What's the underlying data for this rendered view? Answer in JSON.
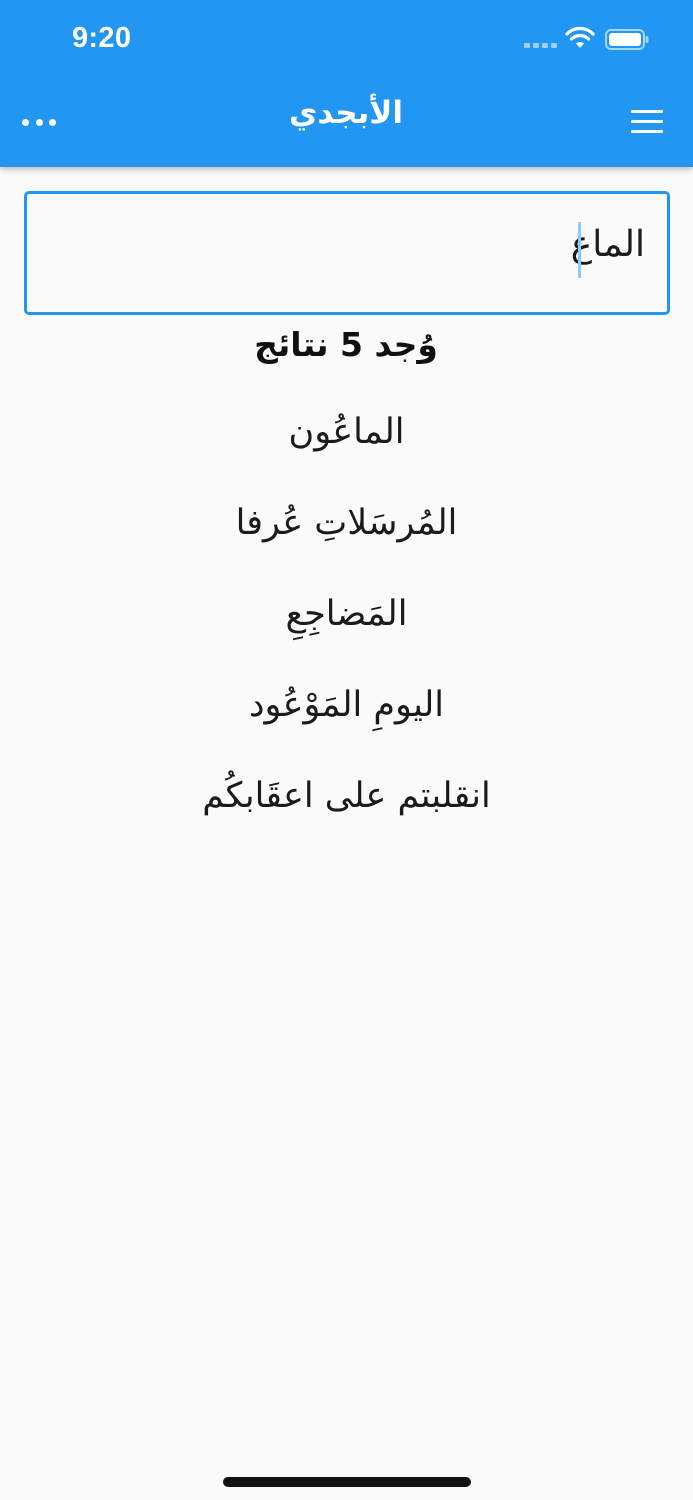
{
  "status_bar": {
    "time": "9:20"
  },
  "app_bar": {
    "title": "الأبجدي",
    "more_icon": "more-horizontal-icon",
    "menu_icon": "hamburger-menu-icon"
  },
  "search": {
    "value": "الماع"
  },
  "results": {
    "count_label": "وُجد 5 نتائج",
    "items": [
      "الماعُون",
      "المُرسَلاتِ عُرفا",
      "المَضاجِعِ",
      "اليومِ المَوْعُود",
      "انقلبتم على اعقَابكُم"
    ]
  },
  "colors": {
    "primary": "#2196f3",
    "background": "#fafafa",
    "text": "#1b1b1b",
    "caret": "#90caf9"
  }
}
